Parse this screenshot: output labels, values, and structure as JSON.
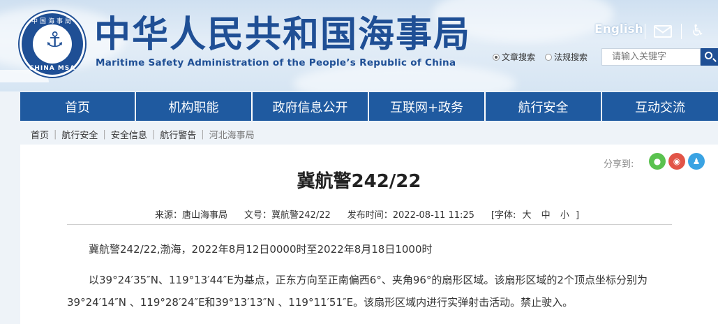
{
  "header": {
    "logo_cn": "中国海事局",
    "logo_en": "CHINA MSA",
    "title_cn": "中华人民共和国海事局",
    "title_en": "Maritime Safety Administration of the People’s Republic of China",
    "lang_link": "English",
    "mail_icon": "mail-icon",
    "accessibility_icon": "accessibility-icon",
    "search": {
      "options": [
        {
          "label": "文章搜索",
          "selected": true
        },
        {
          "label": "法规搜索",
          "selected": false
        }
      ],
      "placeholder": "请输入关键字",
      "button_icon": "search-icon"
    }
  },
  "nav": {
    "items": [
      "首页",
      "机构职能",
      "政府信息公开",
      "互联网+政务",
      "航行安全",
      "互动交流"
    ]
  },
  "breadcrumb": [
    "首页",
    "航行安全",
    "安全信息",
    "航行警告",
    "河北海事局"
  ],
  "article": {
    "share_label": "分享到:",
    "share_icons": [
      "wechat-icon",
      "weibo-icon",
      "qq-icon"
    ],
    "title": "冀航警242/22",
    "meta": {
      "source": "来源：唐山海事局",
      "doc_no": "文号：冀航警242/22",
      "published": "发布时间：2022-08-11 11:25",
      "font_open": "[字体:",
      "font_sizes": [
        "大",
        "中",
        "小"
      ],
      "font_close": "]"
    },
    "paragraphs": [
      "冀航警242/22,渤海，2022年8月12日0000时至2022年8月18日1000时",
      "以39°24′35″N、119°13′44″E为基点，正东方向至正南偏西6°、夹角96°的扇形区域。该扇形区域的2个顶点坐标分别为",
      "39°24′14″N 、119°28′24″E和39°13′13″N 、119°11′51″E。该扇形区域内进行实弹射击活动。禁止驶入。"
    ]
  }
}
